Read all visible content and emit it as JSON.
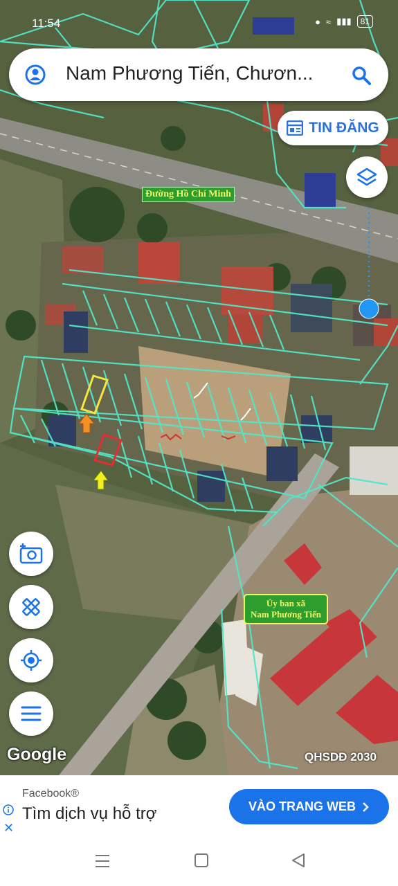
{
  "status_bar": {
    "time": "11:54",
    "battery": "81"
  },
  "search": {
    "query": "Nam Phương Tiến, Chươn..."
  },
  "post_button": {
    "label": "TIN ĐĂNG"
  },
  "map": {
    "road_label": "Đường Hồ Chí Minh",
    "office_label_line1": "Ủy ban xã",
    "office_label_line2": "Nam Phương Tiến",
    "google_logo": "Google",
    "layer_name": "QHSDĐ 2030"
  },
  "ad": {
    "sponsor": "Facebook®",
    "headline": "Tìm dịch vụ hỗ trợ",
    "cta": "VÀO TRANG WEB"
  },
  "colors": {
    "parcel": "#52e6c8",
    "accent": "#2d73d9",
    "cta": "#1a73e8",
    "location": "#2196f3"
  }
}
